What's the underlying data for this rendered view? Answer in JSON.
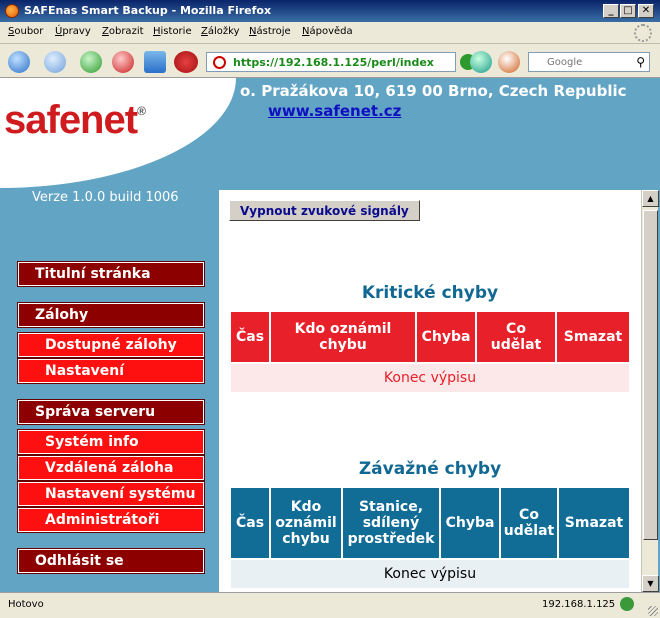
{
  "window": {
    "title": "SAFEnas Smart Backup - Mozilla Firefox",
    "min": "_",
    "max": "□",
    "close": "✕"
  },
  "menu": [
    "Soubor",
    "Úpravy",
    "Zobrazit",
    "Historie",
    "Záložky",
    "Nástroje",
    "Nápověda"
  ],
  "address_bar": {
    "url": "https://192.168.1.125/perl/index"
  },
  "search": {
    "placeholder": "Google"
  },
  "header": {
    "logo": "safenet",
    "logo_mark": "®",
    "address": "o. Pražákova 10, 619 00 Brno, Czech Republic",
    "website": "www.safenet.cz"
  },
  "version": "Verze 1.0.0 build 1006",
  "nav": {
    "title_page": "Titulní stránka",
    "backups": "Zálohy",
    "available_backups": "Dostupné zálohy",
    "settings": "Nastavení",
    "server_admin": "Správa serveru",
    "system_info": "Systém info",
    "remote_backup": "Vzdálená záloha",
    "system_settings": "Nastavení systému",
    "administrators": "Administrátoři",
    "logout": "Odhlásit se"
  },
  "beep_button": "Vypnout zvukové signály",
  "critical": {
    "title": "Kritické chyby",
    "headers": [
      "Čas",
      "Kdo oznámil chybu",
      "Chyba",
      "Co udělat",
      "Smazat"
    ],
    "empty": "Konec výpisu"
  },
  "severe": {
    "title": "Závažné chyby",
    "headers": [
      "Čas",
      "Kdo oznámil chybu",
      "Stanice, sdílený prostředek",
      "Chyba",
      "Co udělat",
      "Smazat"
    ],
    "empty": "Konec výpisu"
  },
  "status": {
    "text": "Hotovo",
    "host": "192.168.1.125"
  },
  "colors": {
    "accent_red": "#d80000",
    "section_blue": "#116892",
    "page_bg": "#62a4c4"
  }
}
